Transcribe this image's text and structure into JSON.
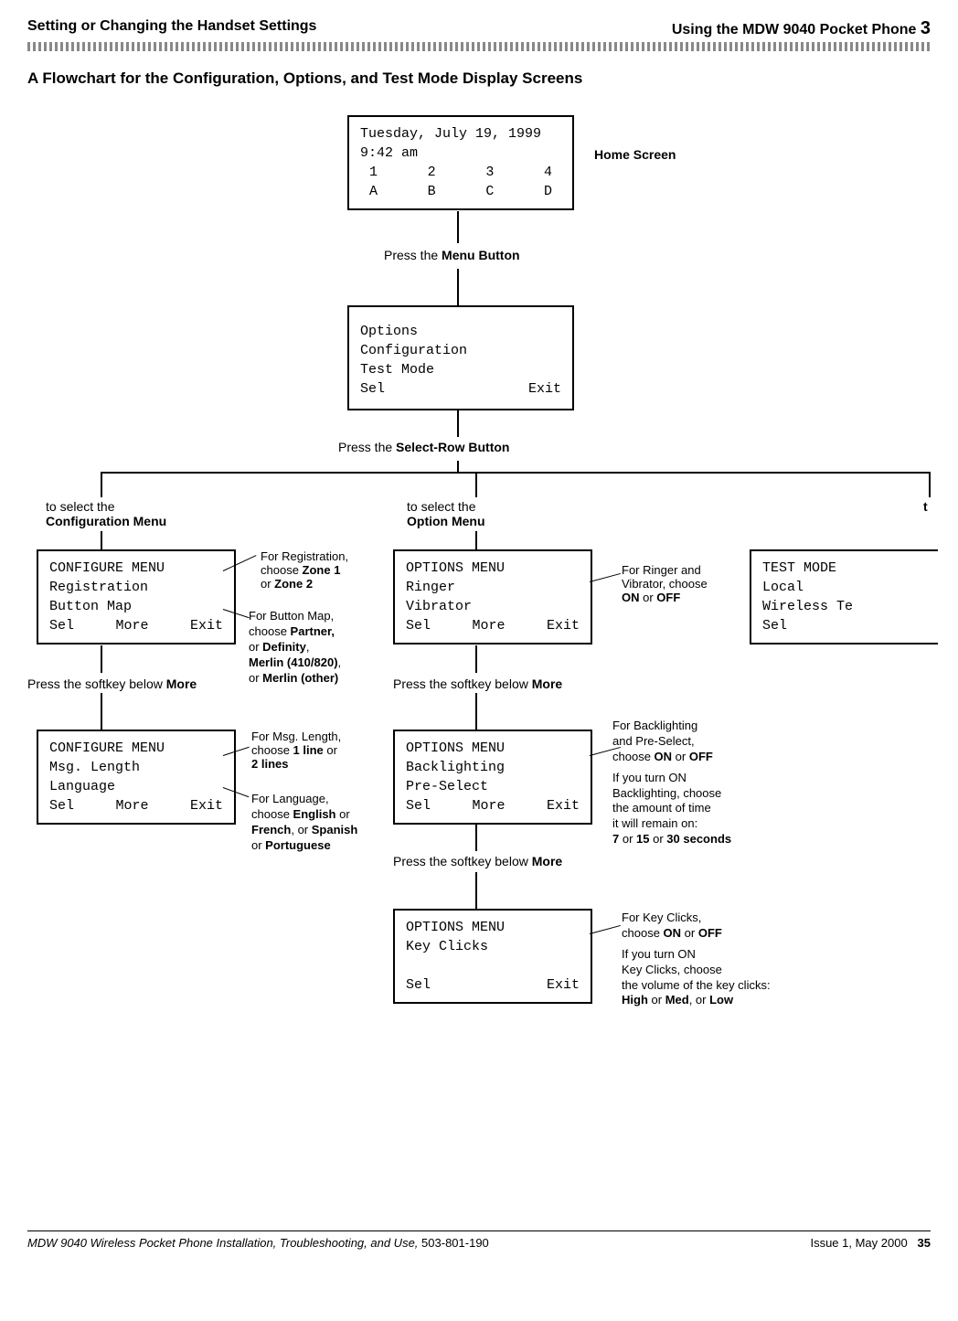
{
  "header": {
    "left": "Setting or Changing the Handset Settings",
    "right": "Using the MDW 9040 Pocket Phone",
    "chapter": "3"
  },
  "sectionTitle": "A Flowchart for the Configuration, Options, and Test Mode Display Screens",
  "homeScreen": {
    "label": "Home Screen",
    "date": "Tuesday, July 19, 1999",
    "time": "9:42 am",
    "row1": [
      "1",
      "2",
      "3",
      "4"
    ],
    "row2": [
      "A",
      "B",
      "C",
      "D"
    ]
  },
  "steps": {
    "pressMenu": "Press the",
    "menuButton": "Menu Button",
    "pressSelectRow": "Press the",
    "selectRowButton": "Select-Row Button",
    "pressSoftkeyMore": "Press the softkey below",
    "more": "More"
  },
  "mainMenu": {
    "line1": "Options",
    "line2": "Configuration",
    "line3": "Test Mode",
    "sel": "Sel",
    "exit": "Exit"
  },
  "branches": {
    "config": {
      "toSelect": "to select the",
      "menuName": "Configuration Menu"
    },
    "option": {
      "toSelect": "to select the",
      "menuName": "Option Menu"
    },
    "testCutoff": "t"
  },
  "configure1": {
    "title": "CONFIGURE MENU",
    "line1": "Registration",
    "line2": "Button Map",
    "sel": "Sel",
    "more": "More",
    "exit": "Exit"
  },
  "configure2": {
    "title": "CONFIGURE MENU",
    "line1": "Msg. Length",
    "line2": "Language",
    "sel": "Sel",
    "more": "More",
    "exit": "Exit"
  },
  "options1": {
    "title": "OPTIONS MENU",
    "line1": "Ringer",
    "line2": "Vibrator",
    "sel": "Sel",
    "more": "More",
    "exit": "Exit"
  },
  "options2": {
    "title": "OPTIONS MENU",
    "line1": "Backlighting",
    "line2": "Pre-Select",
    "sel": "Sel",
    "more": "More",
    "exit": "Exit"
  },
  "options3": {
    "title": "OPTIONS MENU",
    "line1": "Key Clicks",
    "sel": "Sel",
    "exit": "Exit"
  },
  "testMode": {
    "title": "TEST MODE",
    "line1": "Local",
    "line2": "Wireless Te",
    "sel": "Sel"
  },
  "notes": {
    "registration": {
      "l1": "For Registration,",
      "l2a": "choose ",
      "l2b": "Zone 1",
      "l3a": "or ",
      "l3b": "Zone 2"
    },
    "buttonMap": {
      "l1": "For Button Map,",
      "l2a": "choose ",
      "l2b": "Partner,",
      "l3a": "or ",
      "l3b": "Definity",
      "l3c": ",",
      "l4": "Merlin (410/820)",
      "l4c": ",",
      "l5a": "or ",
      "l5b": "Merlin (other)"
    },
    "msgLength": {
      "l1": "For Msg. Length,",
      "l2a": "choose ",
      "l2b": "1 line",
      "l2c": " or",
      "l3": "2 lines"
    },
    "language": {
      "l1": "For Language,",
      "l2a": "choose ",
      "l2b": "English",
      "l2c": " or",
      "l3a": "French",
      "l3b": ", or ",
      "l3c": "Spanish",
      "l4a": "or ",
      "l4b": "Portuguese"
    },
    "ringer": {
      "l1": "For Ringer and",
      "l2": "Vibrator, choose",
      "l3a": "ON",
      "l3b": " or ",
      "l3c": "OFF"
    },
    "backlight": {
      "l1": "For Backlighting",
      "l2": "and Pre-Select,",
      "l3a": "choose ",
      "l3b": "ON",
      "l3c": " or ",
      "l3d": "OFF",
      "l4": "If you turn ON",
      "l5": "Backlighting, choose",
      "l6": "the amount of time",
      "l7": "it will remain on:",
      "l8a": "7",
      "l8b": " or ",
      "l8c": "15",
      "l8d": " or ",
      "l8e": "30 seconds"
    },
    "keyClicks": {
      "l1": "For Key Clicks,",
      "l2a": "choose ",
      "l2b": "ON",
      "l2c": " or ",
      "l2d": "OFF",
      "l3": "If you turn ON",
      "l4": "Key Clicks, choose",
      "l5": "the volume of the key clicks:",
      "l6a": "High",
      "l6b": " or ",
      "l6c": "Med",
      "l6d": ", or ",
      "l6e": "Low"
    }
  },
  "footer": {
    "left": "MDW 9040 Wireless Pocket Phone Installation, Troubleshooting, and Use,",
    "docnum": "503-801-190",
    "issue": "Issue 1, May 2000",
    "page": "35"
  }
}
